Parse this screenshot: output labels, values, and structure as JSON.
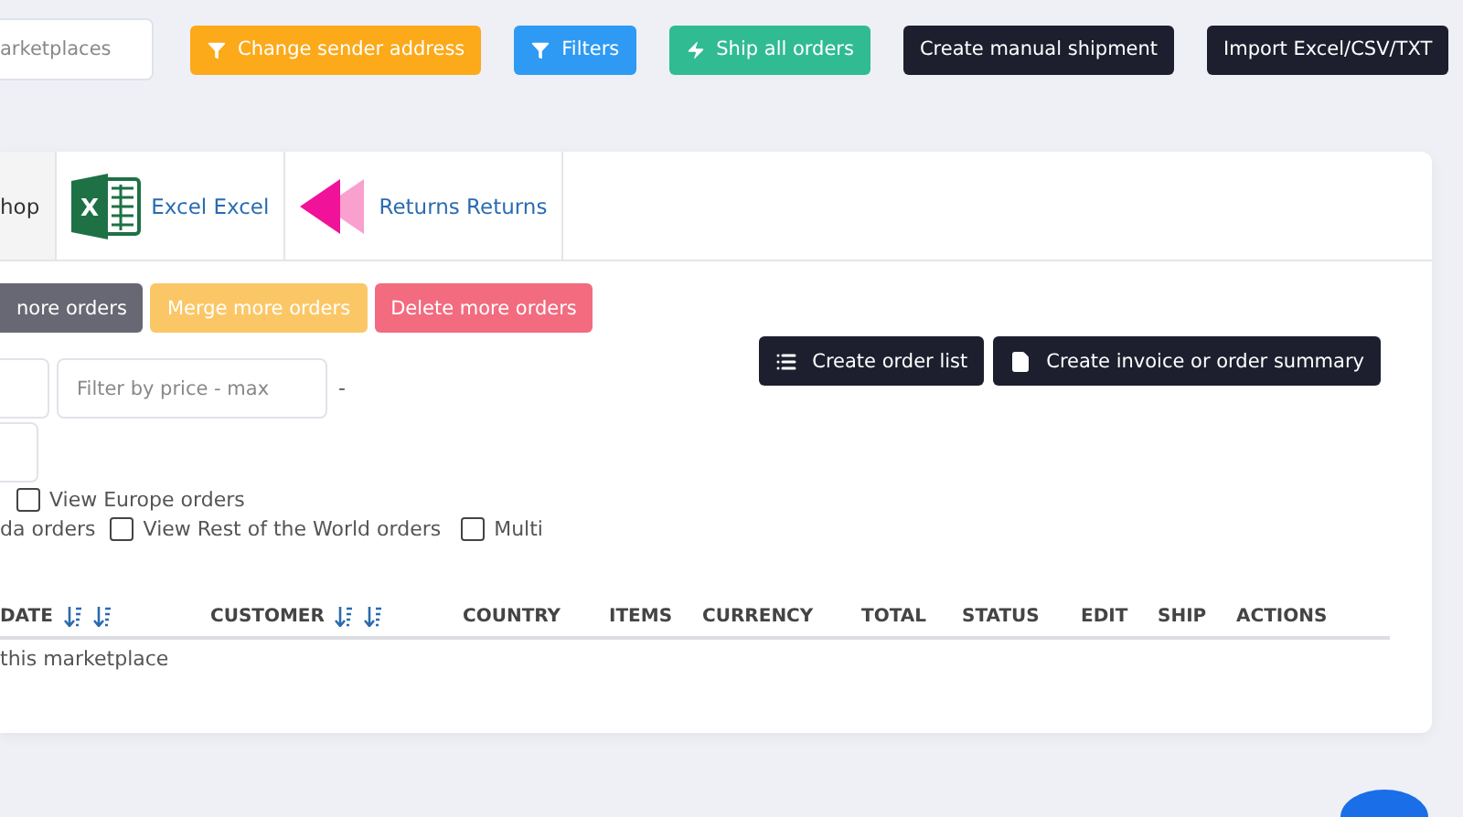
{
  "top_bar": {
    "search": {
      "placeholder": "arketplaces"
    },
    "buttons": [
      {
        "label": "Change sender address",
        "kind": "warning"
      },
      {
        "label": "Filters",
        "kind": "info"
      },
      {
        "label": "Ship all orders",
        "kind": "success"
      },
      {
        "label": "Create manual shipment",
        "kind": "dark"
      },
      {
        "label": "Import Excel/CSV/TXT",
        "kind": "dark"
      }
    ]
  },
  "tabs": [
    {
      "label": "hop",
      "selected": true,
      "kind": "plain"
    },
    {
      "label": "Excel Excel",
      "selected": false,
      "kind": "spreadsheet",
      "logo_letter": "X"
    },
    {
      "label": "Returns Returns",
      "selected": false,
      "kind": "returns"
    }
  ],
  "bulk_buttons": [
    {
      "label": "nore orders",
      "kind": "secondary"
    },
    {
      "label": "Merge more orders",
      "kind": "yellow"
    },
    {
      "label": "Delete more orders",
      "kind": "danger"
    }
  ],
  "filters": {
    "max_field": {
      "placeholder": "Filter by price - max"
    },
    "separator": "-"
  },
  "export_buttons": [
    {
      "label": "Create order list"
    },
    {
      "label": "Create invoice or order summary"
    }
  ],
  "region_filters": [
    [
      {
        "label": "View Europe orders",
        "checked": false
      }
    ],
    [
      {
        "prefix": "da orders"
      },
      {
        "label": "View Rest of the World orders",
        "checked": false
      },
      {
        "label": "Multi",
        "checked": false
      }
    ]
  ],
  "table": {
    "columns": [
      {
        "label": "DATE",
        "kind": "sortable"
      },
      {
        "label": "CUSTOMER",
        "kind": "sortable"
      },
      {
        "label": "COUNTRY",
        "kind": "plain"
      },
      {
        "label": "ITEMS",
        "kind": "plain"
      },
      {
        "label": "CURRENCY",
        "kind": "plain"
      },
      {
        "label": "TOTAL",
        "kind": "plain"
      },
      {
        "label": "STATUS",
        "kind": "plain"
      },
      {
        "label": "EDIT",
        "kind": "plain"
      },
      {
        "label": "SHIP",
        "kind": "plain"
      },
      {
        "label": "ACTIONS",
        "kind": "plain"
      }
    ],
    "empty_message": "this marketplace"
  }
}
